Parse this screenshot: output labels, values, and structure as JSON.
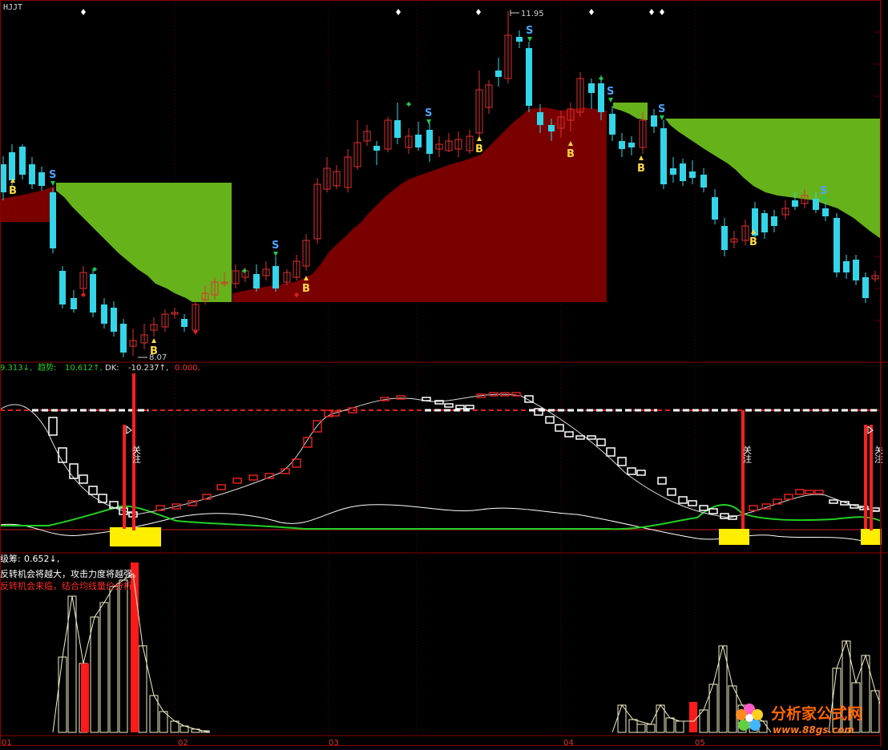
{
  "colors": {
    "background": "#000000",
    "frame": "#8b0000",
    "grid": "#5a0000",
    "up_candle": "#e03030",
    "down_candle": "#33d5e8",
    "support_fill": "#7a0000",
    "resist_fill": "#66b21b",
    "signal_s": "#4ea0ff",
    "signal_b": "#ffd840",
    "trend_dash_red": "#e02020",
    "trend_dash_white": "#ffffff",
    "green_line": "#22d022",
    "white_line": "#ffffff",
    "spike": "#ff2020",
    "yellow_zone": "#ffee00",
    "histo_outline": "#f4f0c8",
    "histo_red": "#ff1a1a",
    "note_red": "#ff2a2a",
    "logo_text": "#ff6600",
    "logo_url": "#ff7a1a"
  },
  "main_panel": {
    "label": "HJJT",
    "price_high": "11.95",
    "price_low": "8.07",
    "sell_marker": "S",
    "buy_marker": "B"
  },
  "mid_panel": {
    "ind1_value": "9.313↓,",
    "trend_label": "趋势:",
    "trend_value": "10.612↑,",
    "dk_label": "DK:",
    "dk_value": "-10.237↑,",
    "extra_value": "0.000,",
    "attention_label": "关注"
  },
  "bottom_panel": {
    "chips_label": "级筹:",
    "chips_value": "0.652↓,",
    "note_line1": "反转机会将越大，攻击力度将越强。",
    "note_line2": "反转机会来临，结合均线量价分析"
  },
  "x_axis": {
    "labels": [
      "01",
      "02",
      "03",
      "04",
      "05"
    ]
  },
  "logo": {
    "name": "分析家公式网",
    "url": "www.88gs.com"
  },
  "chart_data": [
    {
      "type": "candlestick",
      "label": "HJJT",
      "x_labels": [
        "01",
        "02",
        "03",
        "04",
        "05"
      ],
      "annotations": [
        "11.95",
        "8.07"
      ],
      "sell_signals": 7,
      "buy_signals": 7
    },
    {
      "type": "line",
      "series": [
        {
          "name": "趋势",
          "last_value": 10.612
        },
        {
          "name": "DK",
          "last_value": -10.237
        }
      ],
      "annotations": [
        "关注",
        "关注",
        "关注"
      ]
    },
    {
      "type": "bar",
      "series": [
        {
          "name": "级筹",
          "last_value": 0.652
        }
      ]
    }
  ]
}
